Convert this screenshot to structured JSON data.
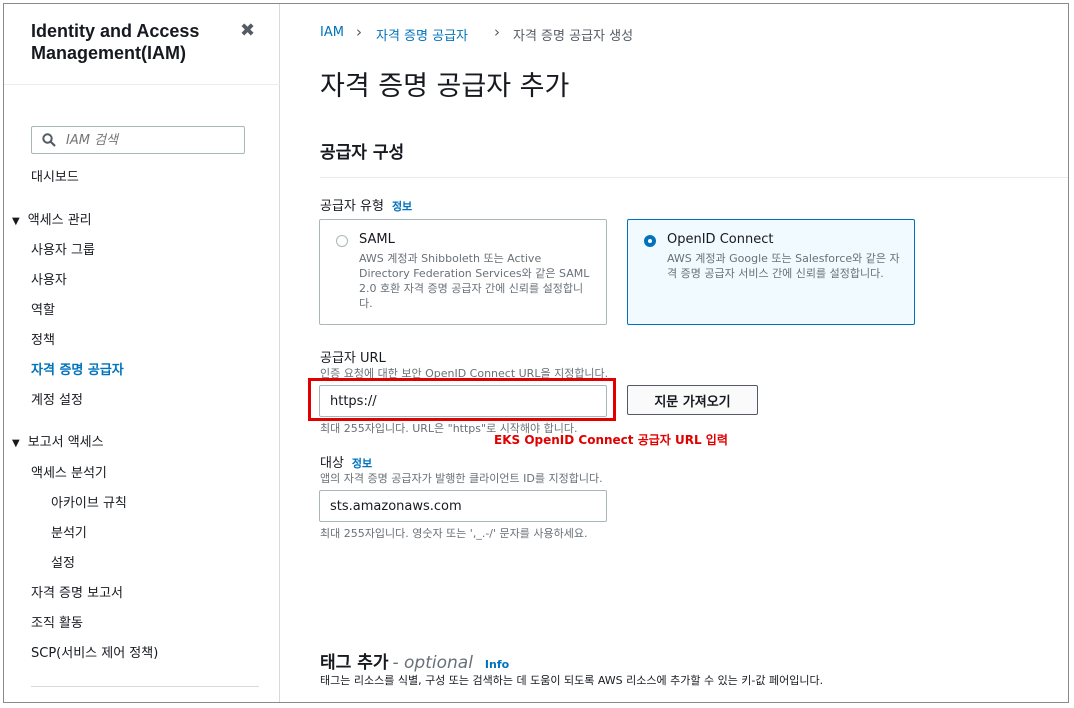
{
  "sidebar": {
    "title": "Identity and Access Management(IAM)",
    "close_icon": "close-icon",
    "search_placeholder": "IAM 검색",
    "dashboard": "대시보드",
    "access_mgmt": {
      "label": "액세스 관리",
      "items": [
        "사용자 그룹",
        "사용자",
        "역할",
        "정책",
        "자격 증명 공급자",
        "계정 설정"
      ],
      "active": "자격 증명 공급자"
    },
    "access_reports": {
      "label": "보고서 액세스",
      "items": [
        "액세스 분석기",
        "아카이브 규칙",
        "분석기",
        "설정",
        "자격 증명 보고서",
        "조직 활동",
        "SCP(서비스 제어 정책)"
      ]
    }
  },
  "breadcrumb": [
    "IAM",
    "자격 증명 공급자",
    "자격 증명 공급자 생성"
  ],
  "page_title": "자격 증명 공급자 추가",
  "section": {
    "title": "공급자 구성",
    "provider_type": {
      "label": "공급자 유형",
      "info": "정보",
      "options": [
        {
          "title": "SAML",
          "desc": "AWS 계정과 Shibboleth 또는 Active Directory Federation Services와 같은 SAML 2.0 호환 자격 증명 공급자 간에 신뢰를 설정합니다.",
          "selected": false
        },
        {
          "title": "OpenID Connect",
          "desc": "AWS 계정과 Google 또는 Salesforce와 같은 자격 증명 공급자 서비스 간에 신뢰를 설정합니다.",
          "selected": true
        }
      ]
    },
    "provider_url": {
      "label": "공급자 URL",
      "hint": "인증 요청에 대한 보안 OpenID Connect URL을 지정합니다.",
      "value": "https://",
      "footer": "최대 255자입니다. URL은 \"https\"로 시작해야 합니다.",
      "button": "지문 가져오기",
      "annotation": "EKS  OpenID Connect 공급자 URL 입력"
    },
    "audience": {
      "label": "대상",
      "info": "정보",
      "hint": "앱의 자격 증명 공급자가 발행한 클라이언트 ID를 지정합니다.",
      "value": "sts.amazonaws.com",
      "footer": "최대 255자입니다. 영숫자 또는 ',_.-/' 문자를 사용하세요."
    }
  },
  "tags": {
    "title": "태그 추가",
    "optional": "- optional",
    "info": "Info",
    "desc": "태그는 리소스를 식별, 구성 또는 검색하는 데 도움이 되도록 AWS 리소스에 추가할 수 있는 키-값 페어입니다."
  },
  "colors": {
    "link": "#0073bb",
    "annotation": "#e00000",
    "selected_bg": "#f1faff"
  }
}
